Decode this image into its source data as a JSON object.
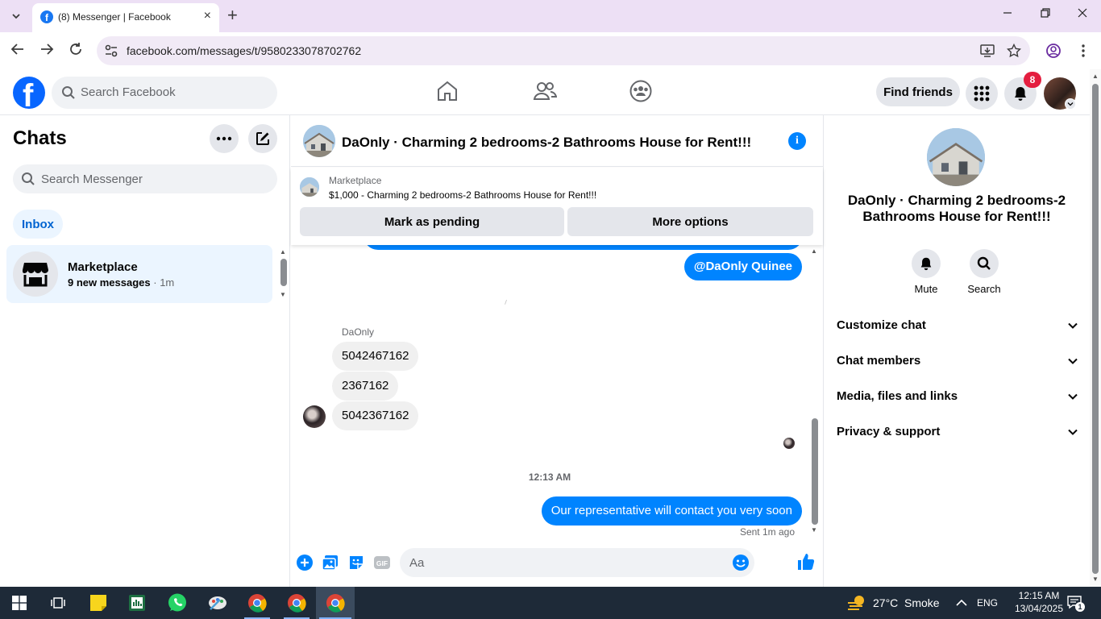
{
  "browser": {
    "tab_title": "(8) Messenger | Facebook",
    "url": "facebook.com/messages/t/9580233078702762"
  },
  "fb_header": {
    "logo_letter": "f",
    "search_placeholder": "Search Facebook",
    "find_friends": "Find friends",
    "notification_count": "8"
  },
  "chats": {
    "title": "Chats",
    "search_placeholder": "Search Messenger",
    "filter": "Inbox",
    "items": [
      {
        "name": "Marketplace",
        "preview": "9 new messages",
        "time": "1m"
      }
    ]
  },
  "conversation": {
    "title": "DaOnly · Charming 2 bedrooms-2 Bathrooms House for Rent!!!",
    "banner": {
      "label": "Marketplace",
      "listing": "$1,000 - Charming 2 bedrooms-2 Bathrooms House for Rent!!!",
      "mark_pending": "Mark as pending",
      "more_options": "More options"
    },
    "messages": {
      "mention": "@DaOnly Quinee",
      "sender": "DaOnly",
      "incoming": [
        "5042467162",
        "2367162",
        "5042367162"
      ],
      "timestamp": "12:13 AM",
      "outgoing": "Our representative will contact you very soon",
      "status": "Sent 1m ago"
    },
    "composer_placeholder": "Aa"
  },
  "details": {
    "title": "DaOnly · Charming 2 bedrooms-2 Bathrooms House for Rent!!!",
    "actions": {
      "mute": "Mute",
      "search": "Search"
    },
    "sections": [
      "Customize chat",
      "Chat members",
      "Media, files and links",
      "Privacy & support"
    ]
  },
  "taskbar": {
    "weather_temp": "27°C",
    "weather_desc": "Smoke",
    "language": "ENG",
    "time": "12:15 AM",
    "date": "13/04/2025",
    "notification_count": "1"
  },
  "colors": {
    "fb_blue": "#0866ff",
    "messenger_blue": "#0084ff",
    "badge_red": "#e41e3f",
    "chrome_tab_bg": "#ede0f5"
  }
}
